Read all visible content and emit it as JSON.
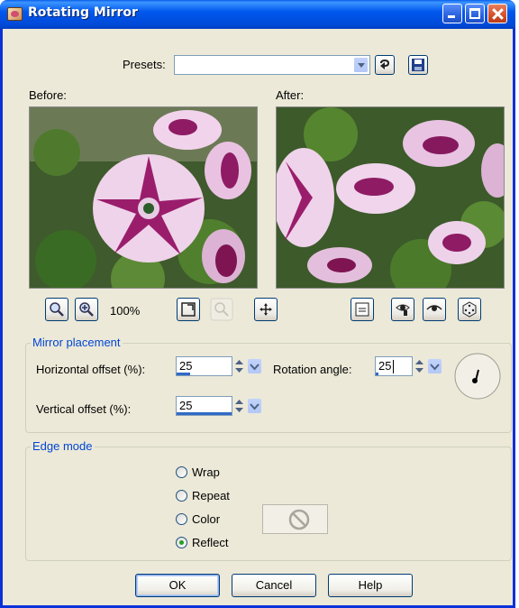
{
  "window": {
    "title": "Rotating Mirror"
  },
  "presets": {
    "label": "Presets:",
    "value": ""
  },
  "preview": {
    "before_label": "Before:",
    "after_label": "After:",
    "zoom": "100%"
  },
  "mirror_placement": {
    "title": "Mirror placement",
    "horizontal_label": "Horizontal offset (%):",
    "horizontal_value": "25",
    "vertical_label": "Vertical offset (%):",
    "vertical_value": "25",
    "rotation_label": "Rotation angle:",
    "rotation_value": "25"
  },
  "edge_mode": {
    "title": "Edge mode",
    "options": [
      "Wrap",
      "Repeat",
      "Color",
      "Reflect"
    ],
    "selected": "Reflect"
  },
  "buttons": {
    "ok": "OK",
    "cancel": "Cancel",
    "help": "Help"
  },
  "icons": [
    "app-icon",
    "dropdown-arrow-icon",
    "reset-icon",
    "save-icon",
    "zoom-out-icon",
    "zoom-in-icon",
    "fit-window-icon",
    "zoom-disabled-icon",
    "pan-icon",
    "proof-icon",
    "auto-proof-icon",
    "show-hide-icon",
    "randomize-icon",
    "angle-dial-icon",
    "no-color-icon"
  ]
}
